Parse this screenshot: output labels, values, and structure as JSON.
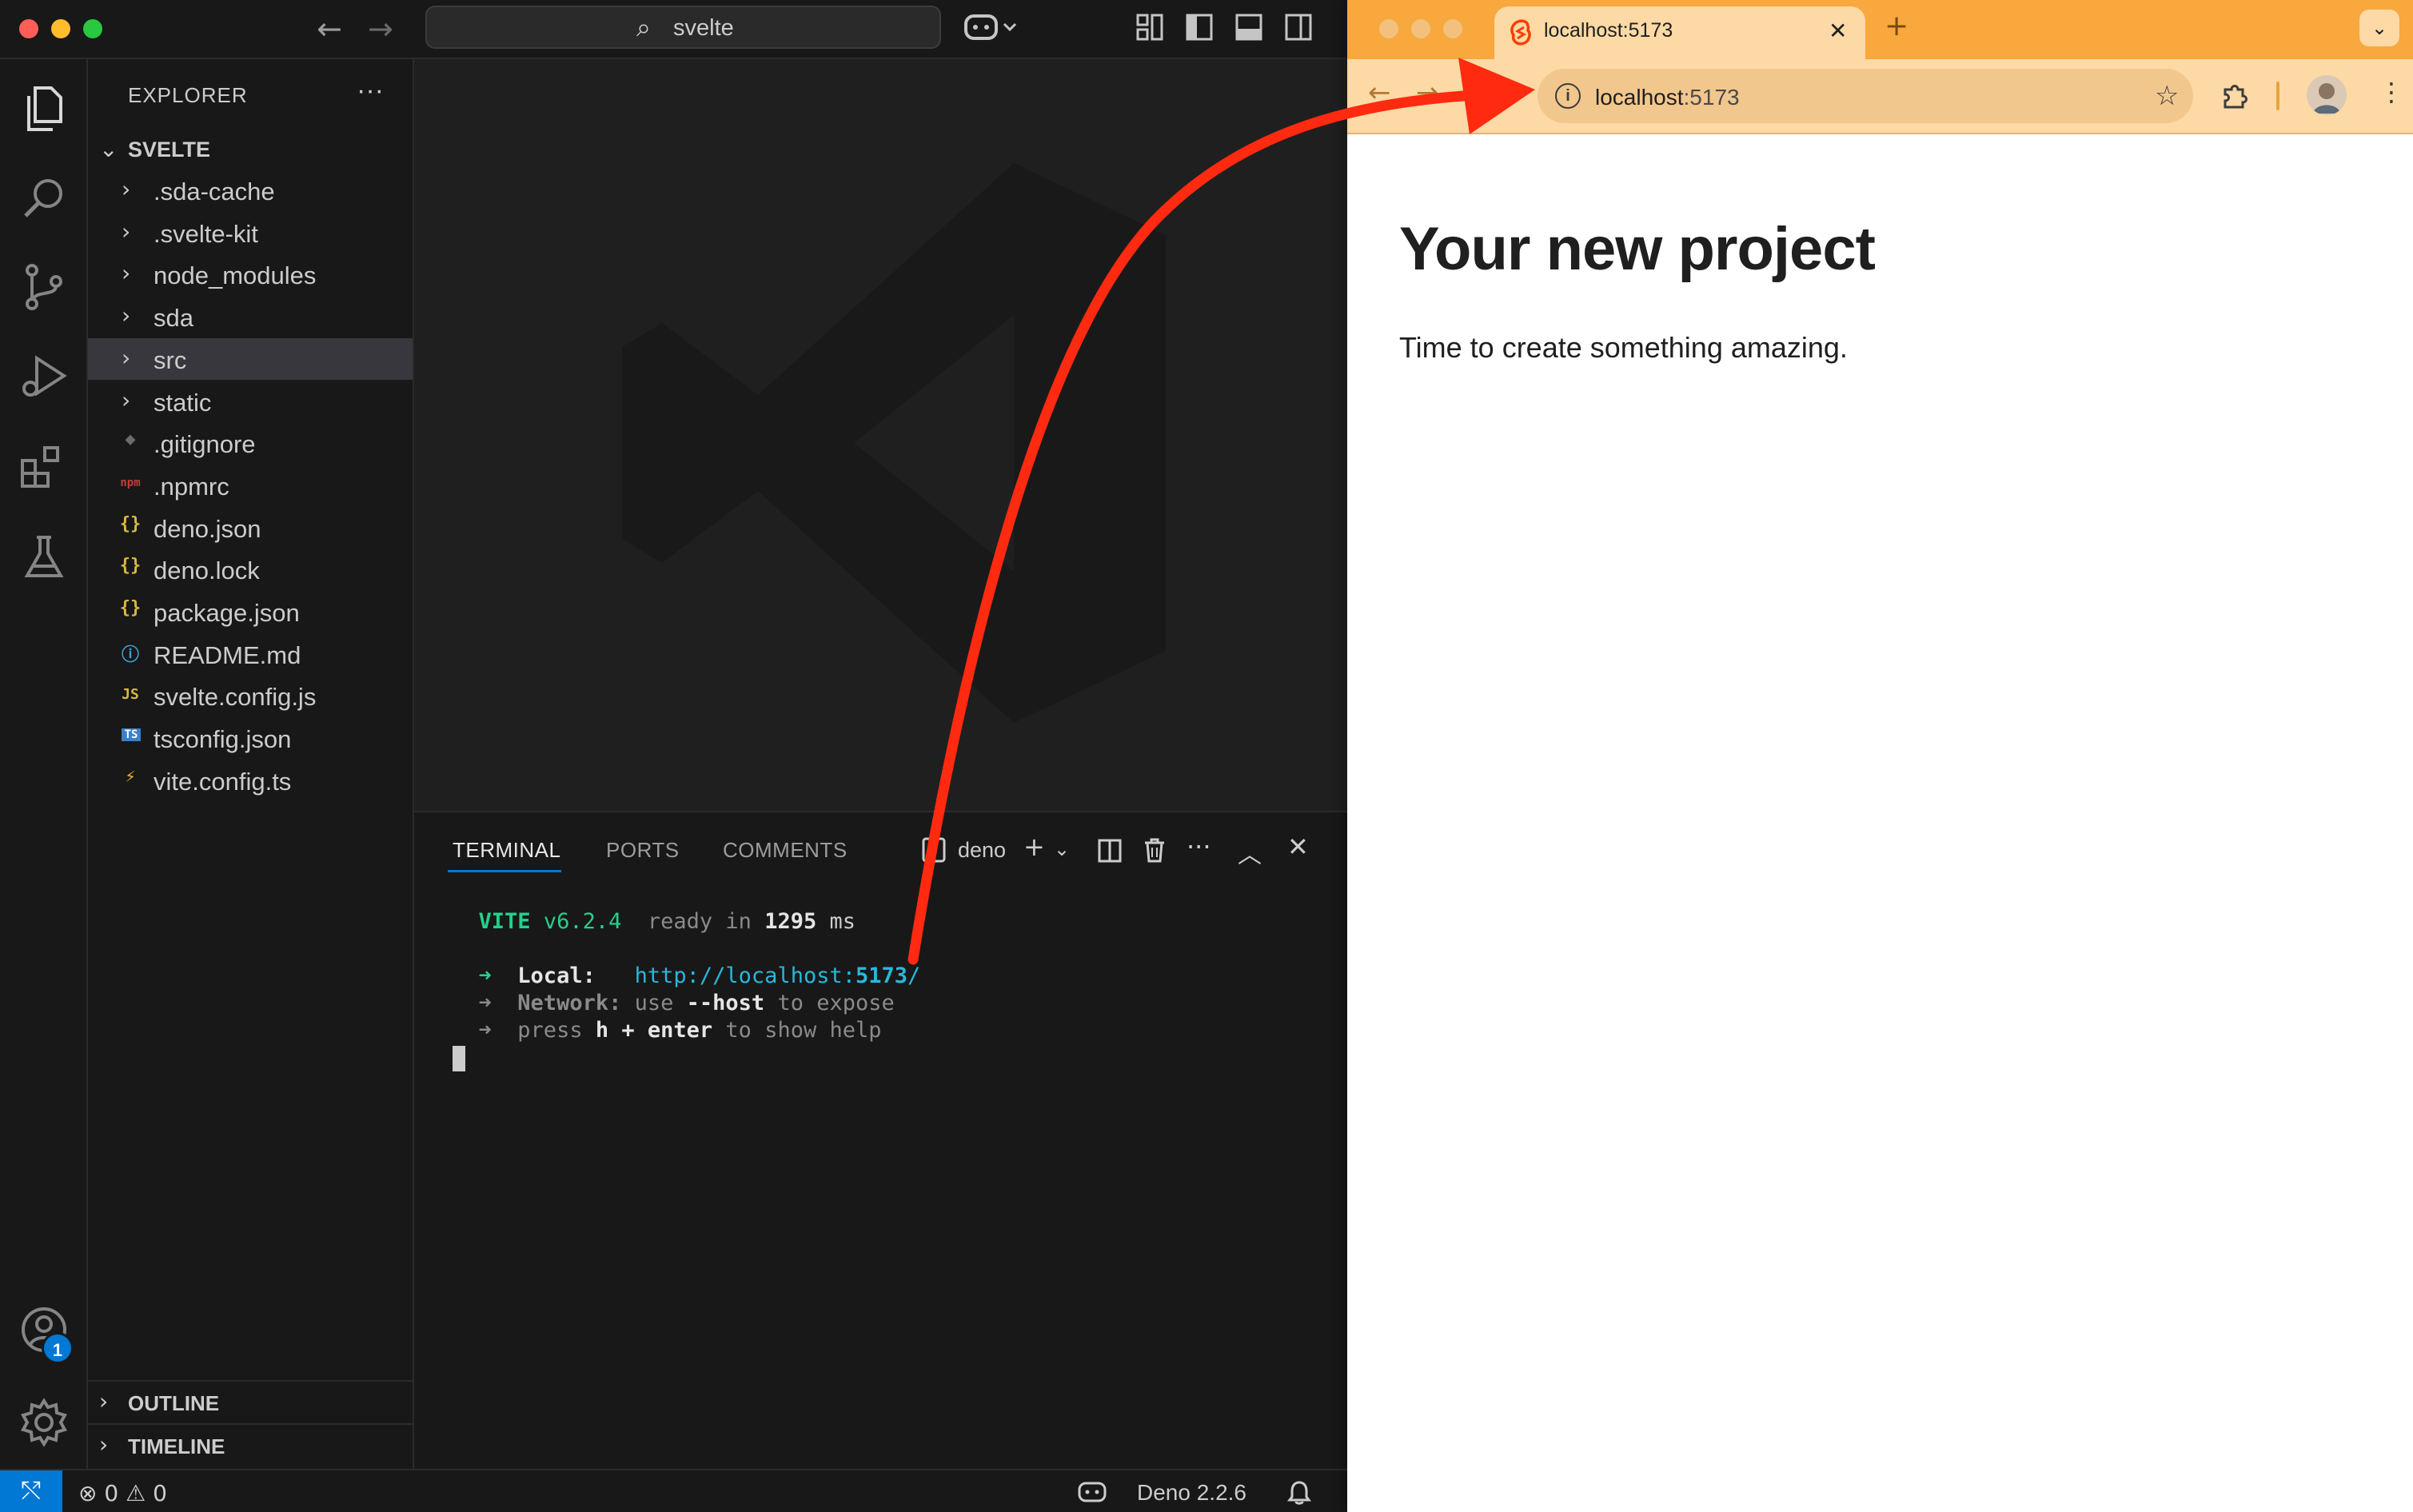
{
  "vscode": {
    "search_box": "svelte",
    "explorer": {
      "title": "EXPLORER",
      "folder": "SVELTE",
      "items": [
        {
          "label": ".sda-cache",
          "type": "folder"
        },
        {
          "label": ".svelte-kit",
          "type": "folder"
        },
        {
          "label": "node_modules",
          "type": "folder"
        },
        {
          "label": "sda",
          "type": "folder"
        },
        {
          "label": "src",
          "type": "folder",
          "selected": true
        },
        {
          "label": "static",
          "type": "folder"
        },
        {
          "label": ".gitignore",
          "type": "file",
          "icon": "git-icon",
          "glyph": "◆",
          "color": "#6b6b6b"
        },
        {
          "label": ".npmrc",
          "type": "file",
          "icon": "npm-icon",
          "glyph": "npm",
          "color": "#c63c3c"
        },
        {
          "label": "deno.json",
          "type": "file",
          "icon": "json-icon",
          "glyph": "{}",
          "color": "#d7ba3d"
        },
        {
          "label": "deno.lock",
          "type": "file",
          "icon": "json-icon",
          "glyph": "{}",
          "color": "#d7ba3d"
        },
        {
          "label": "package.json",
          "type": "file",
          "icon": "json-icon",
          "glyph": "{}",
          "color": "#d7ba3d"
        },
        {
          "label": "README.md",
          "type": "file",
          "icon": "info-icon",
          "glyph": "ⓘ",
          "color": "#3d9fd7"
        },
        {
          "label": "svelte.config.js",
          "type": "file",
          "icon": "js-icon",
          "glyph": "JS",
          "color": "#d7ba3d"
        },
        {
          "label": "tsconfig.json",
          "type": "file",
          "icon": "ts-icon",
          "glyph": "TS",
          "color": "#3d7fc4"
        },
        {
          "label": "vite.config.ts",
          "type": "file",
          "icon": "vite-icon",
          "glyph": "⚡",
          "color": "#f0b62b"
        }
      ],
      "outline": "OUTLINE",
      "timeline": "TIMELINE"
    },
    "panel": {
      "tabs": [
        "TERMINAL",
        "PORTS",
        "COMMENTS"
      ],
      "active_tab": "TERMINAL",
      "terminal_name": "deno"
    },
    "terminal": {
      "vite": "VITE",
      "version": "v6.2.4",
      "ready": "ready in",
      "ms_value": "1295",
      "ms_unit": "ms",
      "arrow": "➜",
      "local_label": "Local:",
      "local_url_prefix": "http://localhost:",
      "local_url_port": "5173",
      "local_url_suffix": "/",
      "network_label": "Network:",
      "network_use": "use",
      "network_flag": "--host",
      "network_rest": "to expose",
      "help_press": "press",
      "help_key": "h + enter",
      "help_rest": "to show help"
    },
    "statusbar": {
      "errors": "0",
      "warnings": "0",
      "runtime": "Deno 2.2.6"
    },
    "accounts_badge": "1"
  },
  "browser": {
    "tab_title": "localhost:5173",
    "url_host": "localhost",
    "url_port": ":5173",
    "page": {
      "heading": "Your new project",
      "paragraph": "Time to create something amazing."
    }
  },
  "colors": {
    "annotation_arrow": "#ff2a10",
    "browser_accent": "#f8a83c",
    "vscode_accent": "#0078d4"
  }
}
